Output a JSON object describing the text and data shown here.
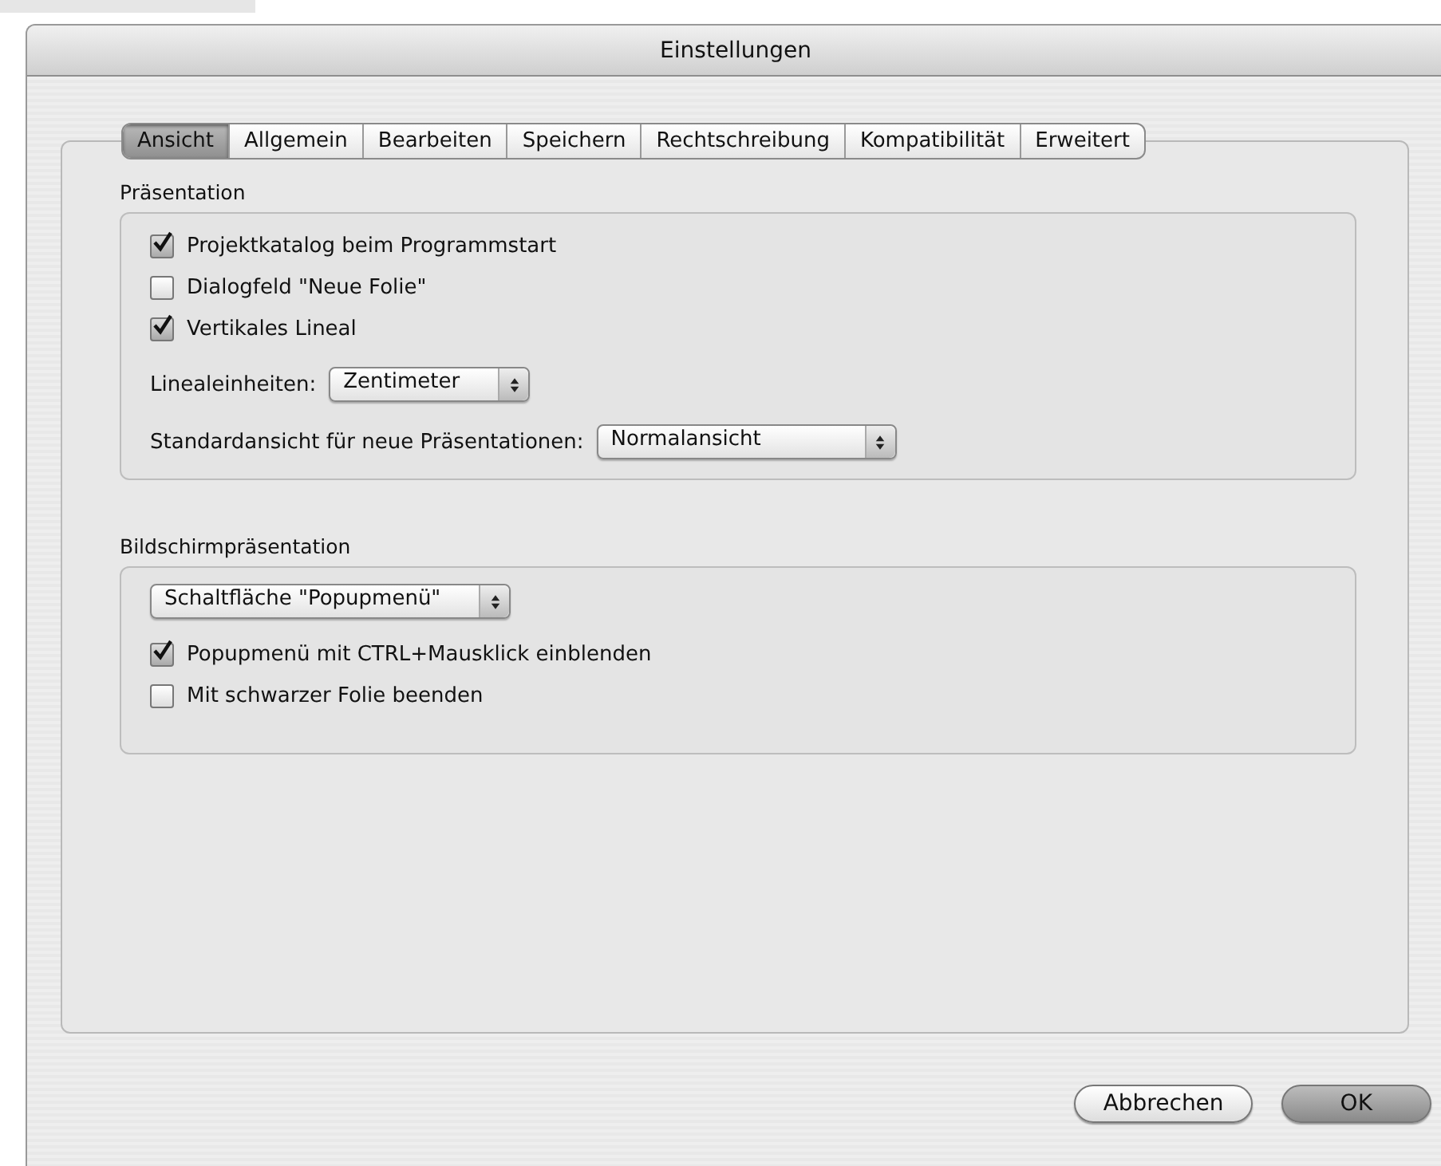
{
  "window": {
    "title": "Einstellungen"
  },
  "tabs": [
    {
      "label": "Ansicht",
      "selected": true
    },
    {
      "label": "Allgemein",
      "selected": false
    },
    {
      "label": "Bearbeiten",
      "selected": false
    },
    {
      "label": "Speichern",
      "selected": false
    },
    {
      "label": "Rechtschreibung",
      "selected": false
    },
    {
      "label": "Kompatibilität",
      "selected": false
    },
    {
      "label": "Erweitert",
      "selected": false
    }
  ],
  "groups": [
    {
      "title": "Präsentation",
      "items": [
        {
          "kind": "checkbox",
          "label": "Projektkatalog beim Programmstart",
          "checked": true
        },
        {
          "kind": "checkbox",
          "label": "Dialogfeld \"Neue Folie\"",
          "checked": false
        },
        {
          "kind": "checkbox",
          "label": "Vertikales Lineal",
          "checked": true
        },
        {
          "kind": "popup",
          "label": "Linealeinheiten:",
          "value": "Zentimeter"
        },
        {
          "kind": "popup",
          "label": "Standardansicht für neue Präsentationen:",
          "value": "Normalansicht"
        }
      ]
    },
    {
      "title": "Bildschirmpräsentation",
      "items": [
        {
          "kind": "popup",
          "value": "Schaltfläche \"Popupmenü\""
        },
        {
          "kind": "checkbox",
          "label": "Popupmenü mit CTRL+Mausklick einblenden",
          "checked": true
        },
        {
          "kind": "checkbox",
          "label": "Mit schwarzer Folie beenden",
          "checked": false
        }
      ]
    }
  ],
  "buttons": [
    {
      "label": "Abbrechen",
      "default": false
    },
    {
      "label": "OK",
      "default": true
    }
  ]
}
